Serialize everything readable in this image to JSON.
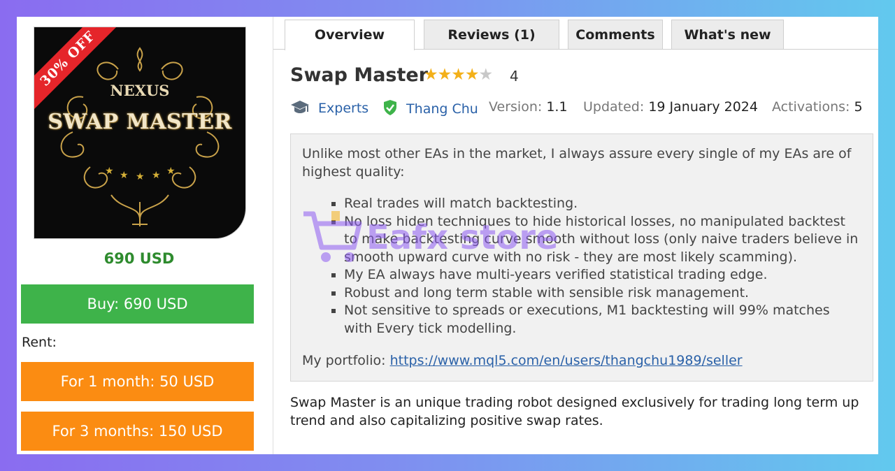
{
  "product": {
    "badge": "30% OFF",
    "logo_top": "NEXUS",
    "logo_main": "SWAP MASTER",
    "price": "690 USD",
    "buy_label": "Buy: 690 USD",
    "rent_label": "Rent:",
    "rent_options": [
      "For 1 month: 50 USD",
      "For 3 months: 150 USD"
    ]
  },
  "tabs": [
    {
      "label": "Overview",
      "active": true
    },
    {
      "label": "Reviews (1)",
      "active": false
    },
    {
      "label": "Comments",
      "active": false
    },
    {
      "label": "What's new",
      "active": false
    }
  ],
  "header": {
    "title": "Swap Master",
    "rating": 4,
    "rating_max": 5,
    "rating_text": "4",
    "category": "Experts",
    "author": "Thang Chu",
    "version_label": "Version:",
    "version": "1.1",
    "updated_label": "Updated:",
    "updated": "19 January 2024",
    "activations_label": "Activations:",
    "activations": "5"
  },
  "description": {
    "intro": "Unlike most other EAs in the market, I always assure every single of my EAs are of highest quality:",
    "bullets": [
      "Real trades will match backtesting.",
      "No loss hiden techniques to hide historical losses, no manipulated backtest to make backtesting curve smooth without loss (only naive traders believe in smooth upward curve with no risk - they are most likely scamming).",
      "My EA always have multi-years verified statistical trading edge.",
      "Robust and long term stable with sensible risk management.",
      "Not sensitive to spreads or executions, M1 backtesting will 99% matches with Every tick modelling."
    ],
    "portfolio_label": "My portfolio:",
    "portfolio_link": "https://www.mql5.com/en/users/thangchu1989/seller"
  },
  "summary": {
    "name": "Swap Master",
    "text": " is an unique trading robot designed exclusively for trading long term up trend and also capitalizing positive swap rates."
  },
  "watermark": "Eafx store",
  "colors": {
    "buy": "#3eb34a",
    "rent": "#fb8c12",
    "price": "#2e8b2e",
    "star": "#f3b019",
    "link": "#2a61a8",
    "badge": "#e5252a"
  }
}
